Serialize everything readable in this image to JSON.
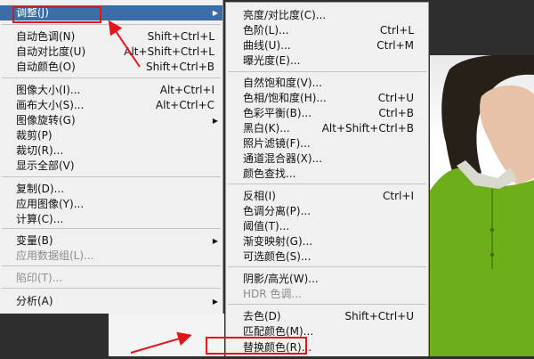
{
  "left_menu": {
    "items": [
      {
        "label": "调整(J)",
        "shortcut": "",
        "submenu": true,
        "disabled": false,
        "highlight": true
      },
      {
        "label": "自动色调(N)",
        "shortcut": "Shift+Ctrl+L",
        "submenu": false,
        "disabled": false
      },
      {
        "label": "自动对比度(U)",
        "shortcut": "Alt+Shift+Ctrl+L",
        "submenu": false,
        "disabled": false
      },
      {
        "label": "自动颜色(O)",
        "shortcut": "Shift+Ctrl+B",
        "submenu": false,
        "disabled": false
      },
      {
        "label": "图像大小(I)...",
        "shortcut": "Alt+Ctrl+I",
        "submenu": false,
        "disabled": false
      },
      {
        "label": "画布大小(S)...",
        "shortcut": "Alt+Ctrl+C",
        "submenu": false,
        "disabled": false
      },
      {
        "label": "图像旋转(G)",
        "shortcut": "",
        "submenu": true,
        "disabled": false
      },
      {
        "label": "裁剪(P)",
        "shortcut": "",
        "submenu": false,
        "disabled": false
      },
      {
        "label": "裁切(R)...",
        "shortcut": "",
        "submenu": false,
        "disabled": false
      },
      {
        "label": "显示全部(V)",
        "shortcut": "",
        "submenu": false,
        "disabled": false
      },
      {
        "label": "复制(D)...",
        "shortcut": "",
        "submenu": false,
        "disabled": false
      },
      {
        "label": "应用图像(Y)...",
        "shortcut": "",
        "submenu": false,
        "disabled": false
      },
      {
        "label": "计算(C)...",
        "shortcut": "",
        "submenu": false,
        "disabled": false
      },
      {
        "label": "变量(B)",
        "shortcut": "",
        "submenu": true,
        "disabled": false
      },
      {
        "label": "应用数据组(L)...",
        "shortcut": "",
        "submenu": false,
        "disabled": true
      },
      {
        "label": "陷印(T)...",
        "shortcut": "",
        "submenu": false,
        "disabled": true
      },
      {
        "label": "分析(A)",
        "shortcut": "",
        "submenu": true,
        "disabled": false
      }
    ]
  },
  "adjust_submenu": {
    "items": [
      {
        "label": "亮度/对比度(C)...",
        "shortcut": "",
        "disabled": false
      },
      {
        "label": "色阶(L)...",
        "shortcut": "Ctrl+L",
        "disabled": false
      },
      {
        "label": "曲线(U)...",
        "shortcut": "Ctrl+M",
        "disabled": false
      },
      {
        "label": "曝光度(E)...",
        "shortcut": "",
        "disabled": false
      },
      {
        "label": "自然饱和度(V)...",
        "shortcut": "",
        "disabled": false
      },
      {
        "label": "色相/饱和度(H)...",
        "shortcut": "Ctrl+U",
        "disabled": false
      },
      {
        "label": "色彩平衡(B)...",
        "shortcut": "Ctrl+B",
        "disabled": false
      },
      {
        "label": "黑白(K)...",
        "shortcut": "Alt+Shift+Ctrl+B",
        "disabled": false
      },
      {
        "label": "照片滤镜(F)...",
        "shortcut": "",
        "disabled": false
      },
      {
        "label": "通道混合器(X)...",
        "shortcut": "",
        "disabled": false
      },
      {
        "label": "颜色查找...",
        "shortcut": "",
        "disabled": false
      },
      {
        "label": "反相(I)",
        "shortcut": "Ctrl+I",
        "disabled": false
      },
      {
        "label": "色调分离(P)...",
        "shortcut": "",
        "disabled": false
      },
      {
        "label": "阈值(T)...",
        "shortcut": "",
        "disabled": false
      },
      {
        "label": "渐变映射(G)...",
        "shortcut": "",
        "disabled": false
      },
      {
        "label": "可选颜色(S)...",
        "shortcut": "",
        "disabled": false
      },
      {
        "label": "阴影/高光(W)...",
        "shortcut": "",
        "disabled": false
      },
      {
        "label": "HDR 色调...",
        "shortcut": "",
        "disabled": true
      },
      {
        "label": "去色(D)",
        "shortcut": "Shift+Ctrl+U",
        "disabled": false
      },
      {
        "label": "匹配颜色(M)...",
        "shortcut": "",
        "disabled": false
      },
      {
        "label": "替换颜色(R)...",
        "shortcut": "",
        "disabled": false
      }
    ]
  },
  "icons": {
    "submenu_arrow": "triangle-right-icon",
    "annotation": "red-arrow-icon"
  },
  "colors": {
    "highlight": "#3b6ea8",
    "annotation": "#e0161b",
    "shirt_green": "#6fae1b",
    "menu_bg": "#f0f0f0",
    "canvas_dark": "#2e2e2e"
  }
}
